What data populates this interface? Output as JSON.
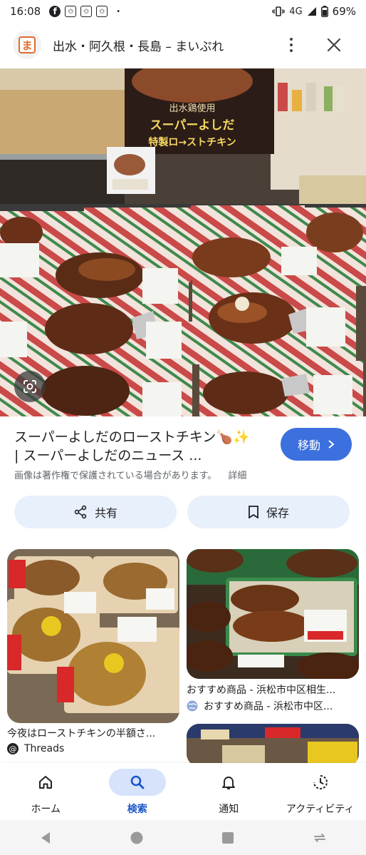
{
  "status_bar": {
    "time": "16:08",
    "network": "4G",
    "battery": "69%",
    "dot": "•"
  },
  "header": {
    "favicon_letter": "ま",
    "title": "出水・阿久根・長島 – まいぷれ"
  },
  "hero_image": {
    "sign_line1": "出水鶏使用",
    "sign_line2": "スーパーよしだ",
    "sign_line3": "特製ロ→ストチキン"
  },
  "result": {
    "title_line1": "スーパーよしだのローストチキン🍗✨",
    "title_line2": "| スーパーよしだのニュース ...",
    "visit_label": "移動",
    "copyright_notice": "画像は著作権で保護されている場合があります。",
    "details_link": "詳細",
    "share_label": "共有",
    "save_label": "保存"
  },
  "related": [
    {
      "caption": "今夜はローストチキンの半額さ...",
      "source": "Threads"
    },
    {
      "caption": "おすすめ商品 - 浜松市中区相生...",
      "source": "おすすめ商品 - 浜松市中区..."
    }
  ],
  "bottom_nav": {
    "items": [
      {
        "label": "ホーム",
        "icon": "home-icon"
      },
      {
        "label": "検索",
        "icon": "search-icon"
      },
      {
        "label": "通知",
        "icon": "bell-icon"
      },
      {
        "label": "アクティビティ",
        "icon": "activity-icon"
      }
    ],
    "active": "検索"
  },
  "colors": {
    "accent": "#3c70de",
    "pill_bg": "#e8f0fb",
    "nav_active_bg": "#d7e3fb",
    "nav_active_text": "#1a56c7"
  }
}
